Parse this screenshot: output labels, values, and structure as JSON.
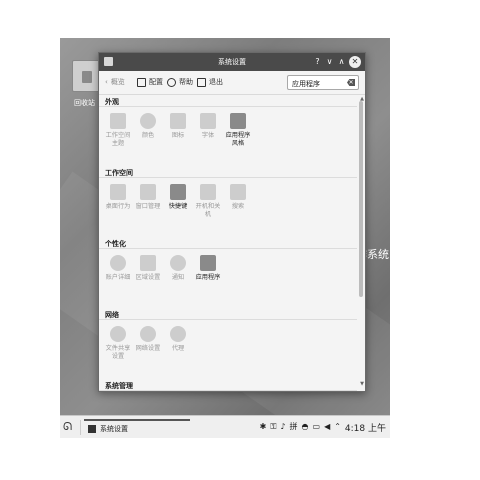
{
  "desktop": {
    "trash_label": "回收站",
    "background_text": "作系统"
  },
  "window": {
    "title": "系统设置",
    "controls": {
      "help": "?",
      "minimize": "∨",
      "maximize": "∧",
      "close": "✕"
    }
  },
  "toolbar": {
    "back_label": "概览",
    "configure_label": "配置",
    "help_label": "帮助",
    "quit_label": "退出",
    "search_value": "应用程序",
    "search_placeholder": ""
  },
  "sections": [
    {
      "title": "外观",
      "items": [
        {
          "label": "工作空间主题",
          "icon": "workspace-theme-icon",
          "active": false
        },
        {
          "label": "颜色",
          "icon": "color-icon",
          "active": false
        },
        {
          "label": "图标",
          "icon": "icons-icon",
          "active": false
        },
        {
          "label": "字体",
          "icon": "font-icon",
          "active": false
        },
        {
          "label": "应用程序风格",
          "icon": "app-style-icon",
          "active": true
        }
      ]
    },
    {
      "title": "工作空间",
      "items": [
        {
          "label": "桌面行为",
          "icon": "desktop-behavior-icon",
          "active": false
        },
        {
          "label": "窗口管理",
          "icon": "window-management-icon",
          "active": false
        },
        {
          "label": "快捷键",
          "icon": "shortcuts-icon",
          "active": true
        },
        {
          "label": "开机和关机",
          "icon": "startup-shutdown-icon",
          "active": false
        },
        {
          "label": "搜索",
          "icon": "search-icon",
          "active": false
        }
      ]
    },
    {
      "title": "个性化",
      "items": [
        {
          "label": "账户详细",
          "icon": "account-icon",
          "active": false
        },
        {
          "label": "区域设置",
          "icon": "regional-settings-icon",
          "active": false
        },
        {
          "label": "通知",
          "icon": "notification-icon",
          "active": false
        },
        {
          "label": "应用程序",
          "icon": "applications-icon",
          "active": true
        }
      ]
    },
    {
      "title": "网络",
      "items": [
        {
          "label": "文件共享设置",
          "icon": "file-sharing-icon",
          "active": false
        },
        {
          "label": "网络设置",
          "icon": "network-settings-icon",
          "active": false
        },
        {
          "label": "代理",
          "icon": "proxy-icon",
          "active": false
        }
      ]
    },
    {
      "title": "系统管理",
      "items": []
    }
  ],
  "taskbar": {
    "task_label": "系统设置",
    "clock": "4:18 上午",
    "tray_icons": [
      "bluetooth-icon",
      "lock-icon",
      "volume-icon",
      "input-method-icon",
      "shield-icon",
      "display-icon",
      "speaker-icon",
      "chevron-up-icon"
    ]
  }
}
